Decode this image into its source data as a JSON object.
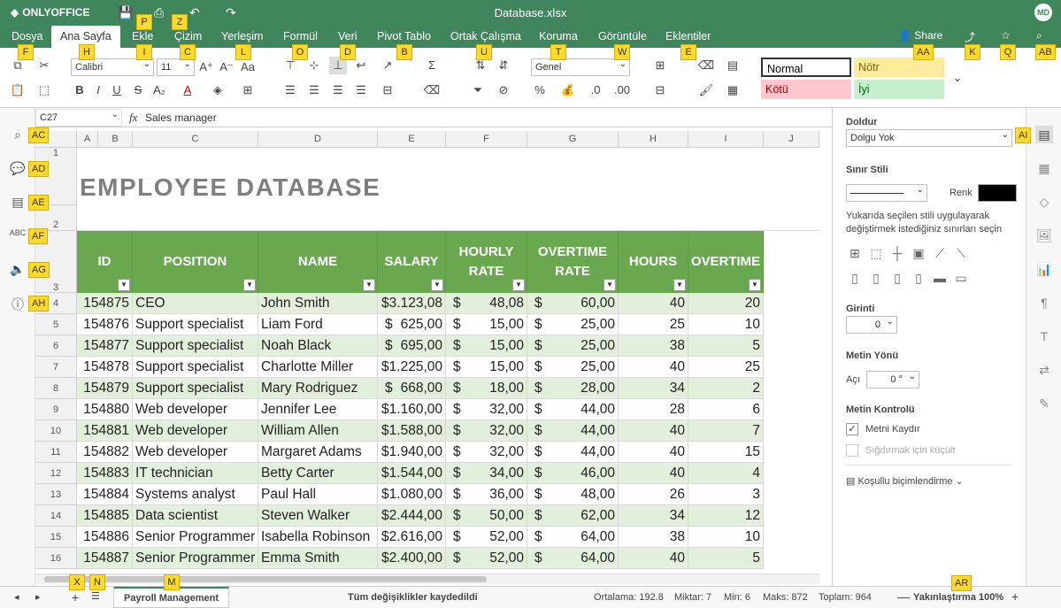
{
  "app": {
    "logo": "ONLYOFFICE",
    "title": "Database.xlsx",
    "avatar": "MD"
  },
  "tabs": [
    "Dosya",
    "Ana Sayfa",
    "Ekle",
    "Çizim",
    "Yerleşim",
    "Formül",
    "Veri",
    "Pivot Tablo",
    "Ortak Çalışma",
    "Koruma",
    "Görüntüle",
    "Eklentiler"
  ],
  "share_label": "Share",
  "toolbar": {
    "font": "Calibri",
    "size": "11",
    "number_format": "Genel",
    "styles": [
      "Normal",
      "Nötr",
      "Kötü",
      "İyi"
    ]
  },
  "formula": {
    "cellref": "C27",
    "fx": "fx",
    "value": "Sales manager"
  },
  "columns": [
    "A",
    "B",
    "C",
    "D",
    "E",
    "F",
    "G",
    "H",
    "I",
    "J"
  ],
  "sheet": {
    "title": "EMPLOYEE DATABASE",
    "headers": [
      "ID",
      "POSITION",
      "NAME",
      "SALARY",
      "HOURLY RATE",
      "OVERTIME RATE",
      "HOURS",
      "OVERTIME"
    ],
    "rows": [
      [
        "154875",
        "CEO",
        "John Smith",
        "$3.123,08",
        "48,08",
        "60,00",
        "40",
        "20"
      ],
      [
        "154876",
        "Support specialist",
        "Liam Ford",
        "625,00",
        "15,00",
        "25,00",
        "25",
        "10"
      ],
      [
        "154877",
        "Support specialist",
        "Noah Black",
        "695,00",
        "15,00",
        "25,00",
        "38",
        "5"
      ],
      [
        "154878",
        "Support specialist",
        "Charlotte Miller",
        "$1.225,00",
        "15,00",
        "25,00",
        "40",
        "25"
      ],
      [
        "154879",
        "Support specialist",
        "Mary Rodriguez",
        "668,00",
        "18,00",
        "28,00",
        "34",
        "2"
      ],
      [
        "154880",
        "Web developer",
        "Jennifer Lee",
        "$1.160,00",
        "32,00",
        "44,00",
        "28",
        "6"
      ],
      [
        "154881",
        "Web developer",
        "William Allen",
        "$1.588,00",
        "32,00",
        "44,00",
        "40",
        "7"
      ],
      [
        "154882",
        "Web developer",
        "Margaret Adams",
        "$1.940,00",
        "32,00",
        "44,00",
        "40",
        "15"
      ],
      [
        "154883",
        "IT technician",
        "Betty Carter",
        "$1.544,00",
        "34,00",
        "46,00",
        "40",
        "4"
      ],
      [
        "154884",
        "Systems analyst",
        "Paul Hall",
        "$1.080,00",
        "36,00",
        "48,00",
        "26",
        "3"
      ],
      [
        "154885",
        "Data scientist",
        "Steven Walker",
        "$2.444,00",
        "50,00",
        "62,00",
        "34",
        "12"
      ],
      [
        "154886",
        "Senior Programmer",
        "Isabella Robinson",
        "$2.616,00",
        "52,00",
        "64,00",
        "38",
        "10"
      ],
      [
        "154887",
        "Senior Programmer",
        "Emma Smith",
        "$2.400,00",
        "52,00",
        "64,00",
        "40",
        "5"
      ]
    ],
    "row_numbers": [
      "1",
      "2",
      "3",
      "4",
      "5",
      "6",
      "7",
      "8",
      "9",
      "10",
      "11",
      "12",
      "13",
      "14",
      "15",
      "16"
    ]
  },
  "panel": {
    "fill_label": "Doldur",
    "fill_value": "Dolgu Yok",
    "border_label": "Sınır Stili",
    "color_label": "Renk",
    "border_help": "Yukarıda seçilen stili uygulayarak değiştirmek istediğiniz sınırları seçin",
    "indent_label": "Girinti",
    "indent_value": "0",
    "orientation_label": "Metin Yönü",
    "angle_label": "Açı",
    "angle_value": "0 °",
    "control_label": "Metin Kontrolü",
    "wrap_label": "Metni Kaydır",
    "shrink_label": "Sığdırmak için küçült",
    "conditional_label": "Koşullu biçimlendirme"
  },
  "status": {
    "sheet_tab": "Payroll Management",
    "saved": "Tüm değişiklikler kaydedildi",
    "average": "Ortalama: 192.8",
    "count": "Miktar: 7",
    "min": "Min: 6",
    "max": "Maks: 872",
    "sum": "Toplam: 964",
    "zoom": "Yakınlaştırma 100%"
  },
  "keytips": [
    "F",
    "H",
    "P",
    "Z",
    "I",
    "C",
    "L",
    "O",
    "D",
    "B",
    "U",
    "T",
    "W",
    "E",
    "AA",
    "K",
    "Q",
    "AB",
    "AC",
    "AD",
    "AE",
    "AF",
    "AG",
    "AH",
    "AI",
    "X",
    "N",
    "M",
    "AR"
  ],
  "colors": {
    "brand": "#40865c",
    "header_green": "#6aa84f",
    "band": "#e2efda",
    "neutral": "#ffeb9c",
    "bad": "#ffc7ce",
    "good": "#c6efce"
  }
}
